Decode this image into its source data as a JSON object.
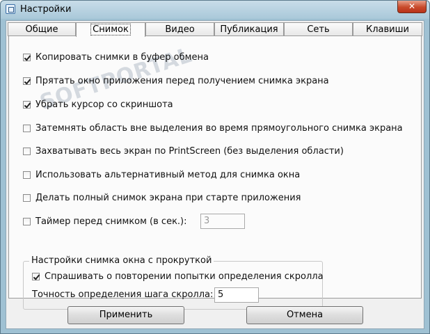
{
  "window": {
    "title": "Настройки",
    "close_glyph": "✕"
  },
  "tabs": [
    {
      "label": "Общие"
    },
    {
      "label": "Снимок",
      "active": true
    },
    {
      "label": "Видео"
    },
    {
      "label": "Публикация"
    },
    {
      "label": "Сеть"
    },
    {
      "label": "Клавиши"
    }
  ],
  "options": [
    {
      "label": "Копировать снимки в буфер обмена",
      "checked": true
    },
    {
      "label": "Прятать окно приложения перед получением снимка экрана",
      "checked": true
    },
    {
      "label": "Убрать курсор со скриншота",
      "checked": true
    },
    {
      "label": "Затемнять область вне выделения во время прямоугольного снимка экрана",
      "checked": false
    },
    {
      "label": "Захватывать весь экран по PrintScreen (без выделения области)",
      "checked": false
    },
    {
      "label": "Использовать альтернативный метод для снимка окна",
      "checked": false
    },
    {
      "label": "Делать полный снимок экрана при старте приложения",
      "checked": false
    },
    {
      "label": "Таймер перед снимком (в сек.):",
      "checked": false
    }
  ],
  "timer": {
    "value": "3",
    "enabled": false
  },
  "scroll_group": {
    "title": "Настройки снимка окна с прокруткой",
    "retry_label": "Спрашивать о повторении попытки определения скролла",
    "retry_checked": true,
    "step_label": "Точность определения шага скролла:",
    "step_value": "5"
  },
  "buttons": {
    "apply": "Применить",
    "cancel": "Отмена"
  },
  "watermark": "SOFTPORTAL"
}
